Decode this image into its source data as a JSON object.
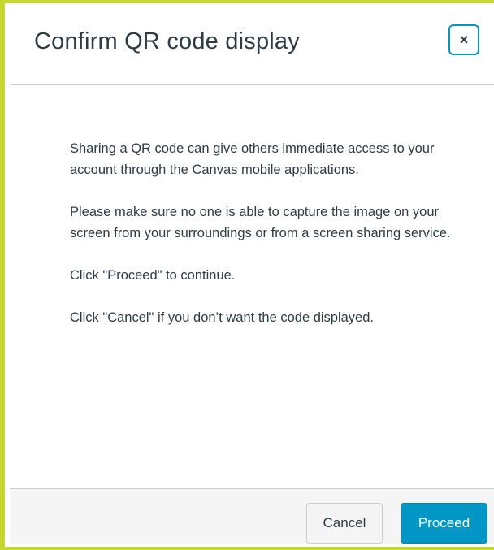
{
  "dialog": {
    "title": "Confirm QR code display",
    "close_icon": "×",
    "paragraphs": [
      "Sharing a QR code can give others immediate access to your account through the Canvas mobile applications.",
      "Please make sure no one is able to capture the image on your screen from your surroundings or from a screen sharing service.",
      "Click \"Proceed\" to continue.",
      "Click \"Cancel\" if you don’t want the code displayed."
    ],
    "buttons": {
      "cancel": "Cancel",
      "proceed": "Proceed"
    }
  },
  "colors": {
    "frame_border": "#c5d82f",
    "accent": "#0096c6",
    "text": "#2d3b45",
    "footer_bg": "#f5f5f5"
  }
}
